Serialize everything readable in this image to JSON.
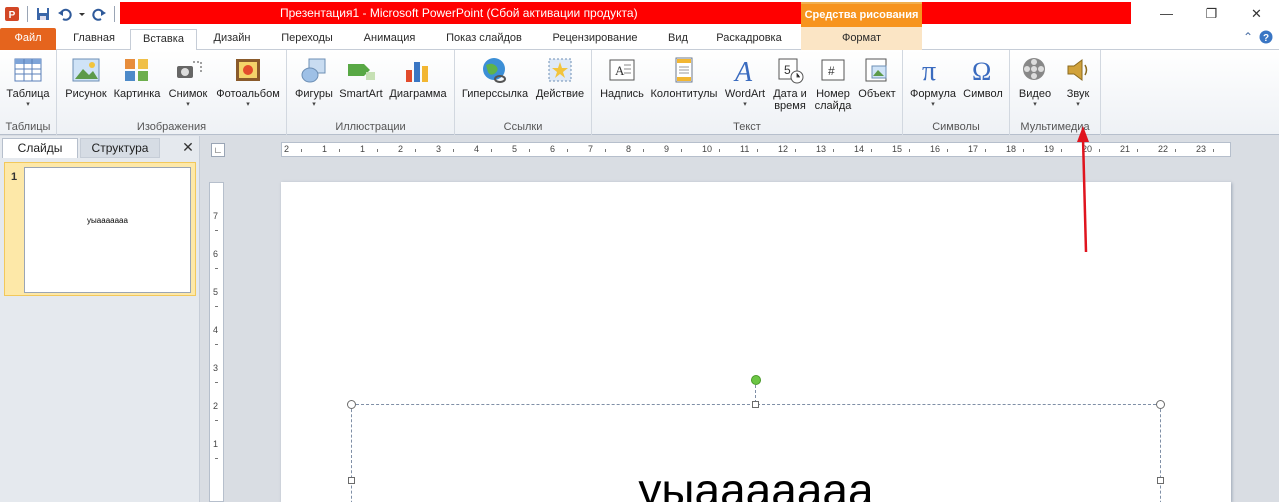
{
  "window": {
    "title": "Презентация1  -  Microsoft PowerPoint (Сбой активации продукта)",
    "context_tab_group": "Средства рисования",
    "controls": [
      "—",
      "❐",
      "✕"
    ]
  },
  "tabs": [
    {
      "label": "Файл"
    },
    {
      "label": "Главная"
    },
    {
      "label": "Вставка"
    },
    {
      "label": "Дизайн"
    },
    {
      "label": "Переходы"
    },
    {
      "label": "Анимация"
    },
    {
      "label": "Показ слайдов"
    },
    {
      "label": "Рецензирование"
    },
    {
      "label": "Вид"
    },
    {
      "label": "Раскадровка"
    },
    {
      "label": "Формат"
    }
  ],
  "ribbon": {
    "groups": {
      "tables": {
        "label": "Таблицы",
        "buttons": {
          "table": "Таблица"
        }
      },
      "images": {
        "label": "Изображения",
        "buttons": {
          "picture": "Рисунок",
          "clipart": "Картинка",
          "screenshot": "Снимок",
          "album": "Фотоальбом"
        }
      },
      "illustrations": {
        "label": "Иллюстрации",
        "buttons": {
          "shapes": "Фигуры",
          "smartart": "SmartArt",
          "chart": "Диаграмма"
        }
      },
      "links": {
        "label": "Ссылки",
        "buttons": {
          "hyperlink": "Гиперссылка",
          "action": "Действие"
        }
      },
      "text": {
        "label": "Текст",
        "buttons": {
          "textbox": "Надпись",
          "header": "Колонтитулы",
          "wordart": "WordArt",
          "datetime_1": "Дата и",
          "datetime_2": "время",
          "slidenum_1": "Номер",
          "slidenum_2": "слайда",
          "object": "Объект"
        }
      },
      "symbols": {
        "label": "Символы",
        "buttons": {
          "equation": "Формула",
          "symbol": "Символ"
        }
      },
      "media": {
        "label": "Мультимедиа",
        "buttons": {
          "video": "Видео",
          "audio": "Звук"
        }
      }
    }
  },
  "slide_pane": {
    "tabs": {
      "slides": "Слайды",
      "outline": "Структура",
      "close": "✕"
    },
    "thumbnails": [
      {
        "number": "1",
        "text": "уыааааааа"
      }
    ]
  },
  "ruler": {
    "horizontal_labels": [
      "2",
      "1",
      "1",
      "2",
      "3",
      "4",
      "5",
      "6",
      "7",
      "8",
      "9",
      "10",
      "11",
      "12",
      "13",
      "14",
      "15",
      "16",
      "17",
      "18",
      "19",
      "20",
      "21",
      "22",
      "23"
    ],
    "vertical_labels": [
      "7",
      "6",
      "5",
      "4",
      "3",
      "2",
      "1"
    ],
    "corner_glyph": "∟"
  },
  "slide": {
    "text": "уыааааааа"
  },
  "colors": {
    "title_bar_highlight": "#ff0000",
    "file_tab": "#e5641d",
    "context_tab": "#f7941e",
    "annotation_arrow": "#e0141e"
  }
}
